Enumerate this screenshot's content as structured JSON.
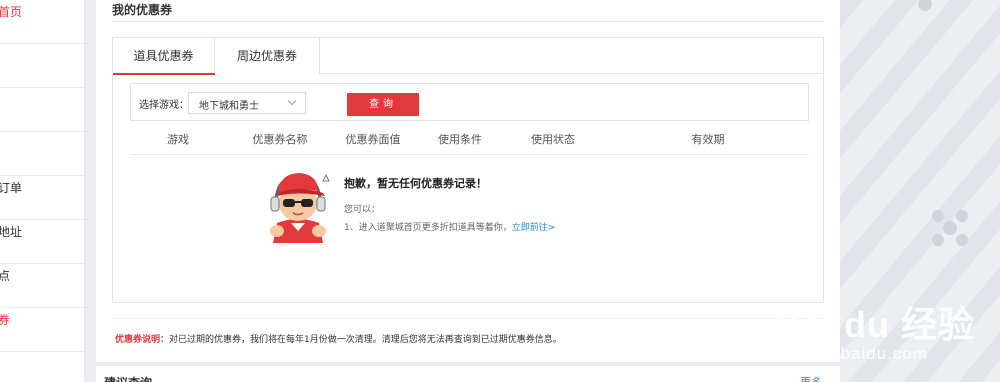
{
  "sidebar": {
    "items": [
      {
        "label": "首页",
        "active": true
      },
      {
        "label": ""
      },
      {
        "label": ""
      },
      {
        "label": ""
      },
      {
        "label": "订单"
      },
      {
        "label": "地址"
      },
      {
        "label": "点"
      },
      {
        "label": "券",
        "active": true
      }
    ]
  },
  "panel": {
    "title": "我的优惠券",
    "tabs": [
      "道具优惠券",
      "周边优惠券"
    ],
    "search": {
      "label": "选择游戏：",
      "selected_game": "地下城和勇士",
      "query_button": "查询"
    },
    "columns": [
      "游戏",
      "优惠券名称",
      "优惠券面值",
      "使用条件",
      "使用状态",
      "有效期"
    ],
    "empty": {
      "title": "抱歉，暂无任何优惠券记录！",
      "subtitle": "您可以：",
      "tip_prefix": "1、进入道聚城首页更多折扣道具等着你，",
      "tip_link": "立即前往>"
    },
    "note": {
      "label": "优惠券说明：",
      "text": "对已过期的优惠券，我们将在每年1月份做一次清理。清理后您将无法再查询到已过期优惠券信息。"
    }
  },
  "panel2": {
    "title": "建议查询",
    "more": "更多"
  },
  "watermark": {
    "brand": "Bai du 经验",
    "url": "jingyan.baidu.com"
  },
  "colors": {
    "accent": "#e4393c",
    "link": "#2a8ad4",
    "background": "#ececf0"
  }
}
